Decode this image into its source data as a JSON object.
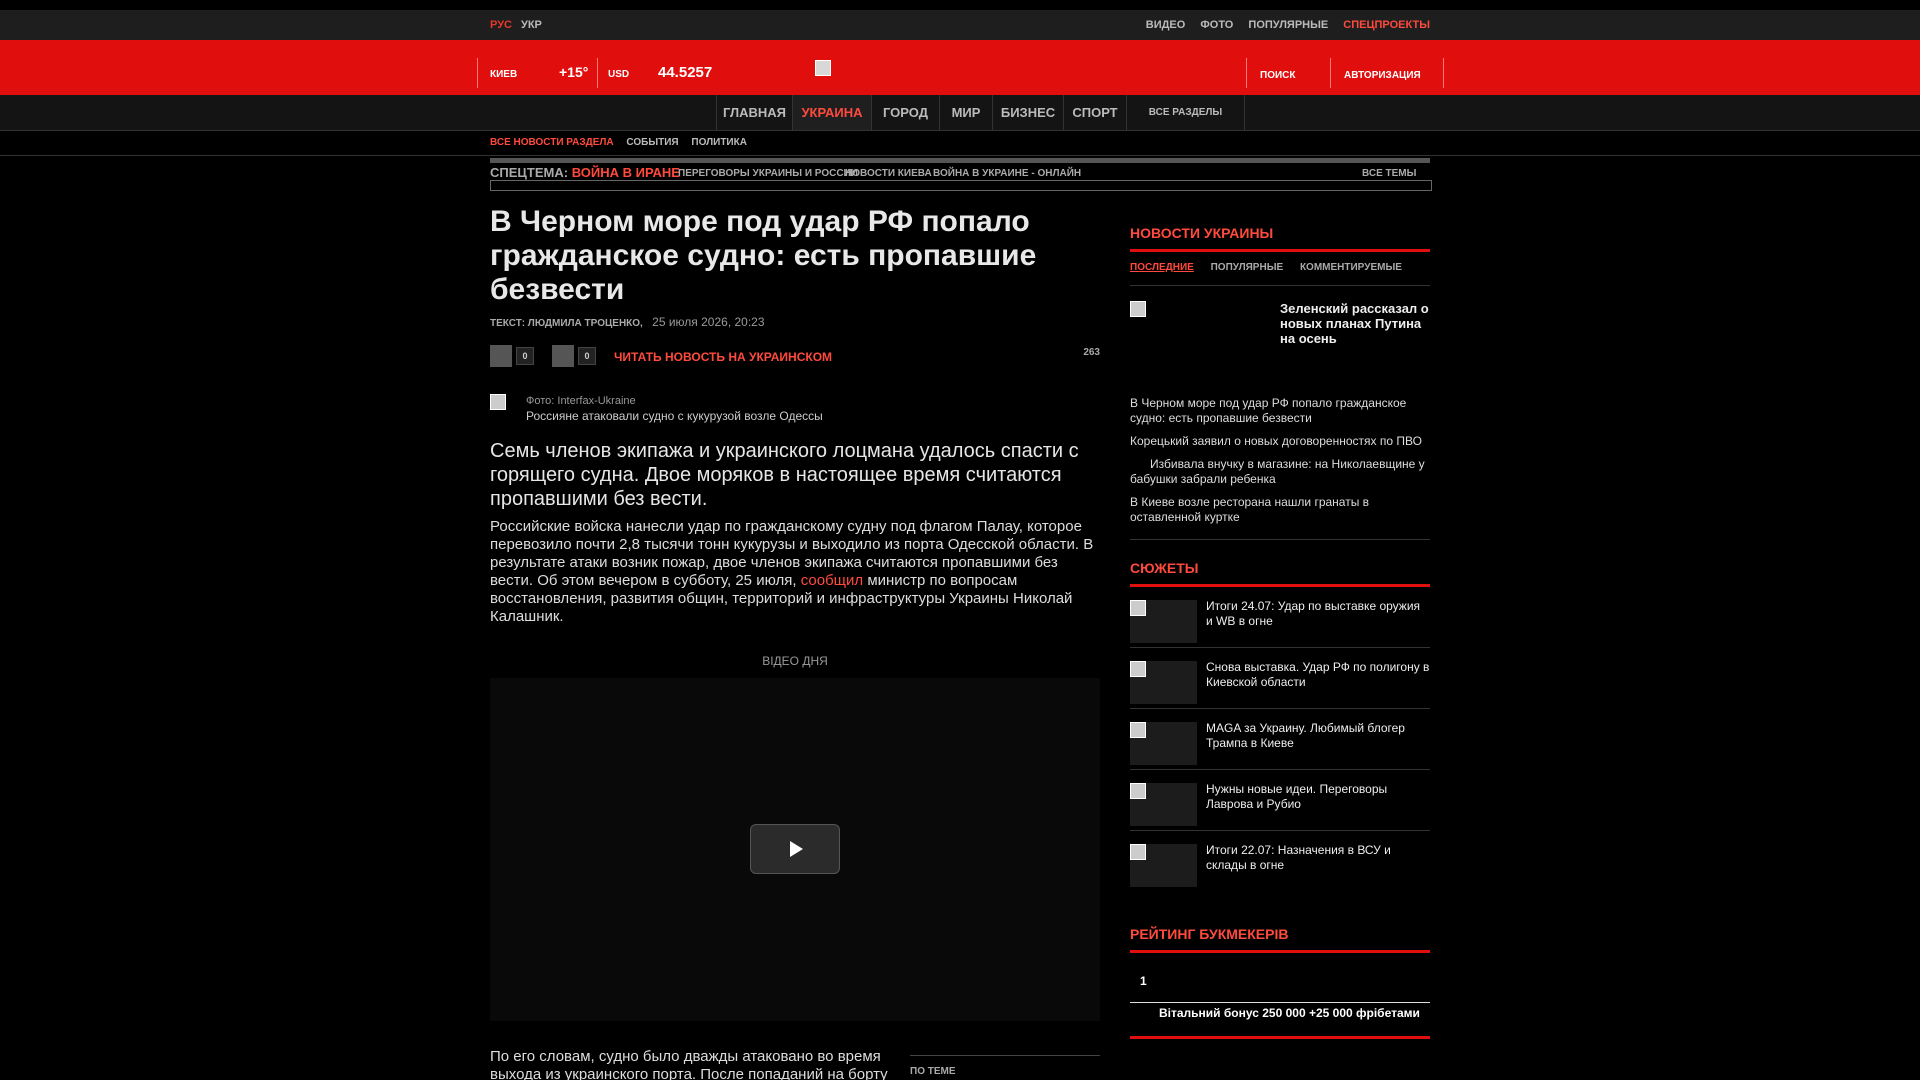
{
  "top": {
    "lang_rus": "РУС",
    "lang_ukr": "УКР",
    "links": [
      "ВИДЕО",
      "ФОТО",
      "ПОПУЛЯРНЫЕ"
    ],
    "special": "СПЕЦПРОЕКТЫ"
  },
  "header": {
    "city": "КИЕВ",
    "temp": "+15°",
    "currency": "USD",
    "rate": "44.5257",
    "search": "ПОИСК",
    "auth": "АВТОРИЗАЦИЯ"
  },
  "nav": {
    "items": [
      "ГЛАВНАЯ",
      "УКРАИНА",
      "ГОРОД",
      "МИР",
      "БИЗНЕС",
      "СПОРТ"
    ],
    "all": "ВСЕ РАЗДЕЛЫ",
    "active_index": 1
  },
  "subnav": [
    "ВСЕ НОВОСТИ РАЗДЕЛА",
    "СОБЫТИЯ",
    "ПОЛИТИКА"
  ],
  "topic": {
    "label": "СПЕЦТЕМА:",
    "highlight": "ВОЙНА В ИРАНЕ",
    "links": [
      "ПЕРЕГОВОРЫ УКРАИНЫ И РОССИИ",
      "НОВОСТИ КИЕВА",
      "ВОЙНА В УКРАИНЕ - ОНЛАЙН"
    ],
    "all": "ВСЕ ТЕМЫ"
  },
  "article": {
    "title": "В Черном море под удар РФ попало гражданское судно: есть пропавшие безвести",
    "author": "ТЕКСТ: ЛЮДМИЛА ТРОЦЕНКО,",
    "date": "25 июля 2026, 20:23",
    "likes": "0",
    "comments": "0",
    "read_ua": "ЧИТАТЬ НОВОСТЬ НА УКРАИНСКОМ",
    "views": "263",
    "photo_credit": "Фото: Interfax-Ukraine",
    "photo_caption": "Россияне атаковали судно с кукурузой возле Одессы",
    "lead": "Семь членов экипажа и украинского лоцмана удалось спасти с горящего судна. Двое моряков в настоящее время считаются пропавшими без вести.",
    "body1_a": "Российские войска нанесли удар по гражданскому судну под флагом Палау, которое перевозило почти 2,8 тысячи тонн кукурузы и выходило из порта Одесской области. В результате атаки возник пожар, двое членов экипажа считаются пропавшими без вести. Об этом вечером в субботу, 25 июля,",
    "body1_link": "сообщил",
    "body1_b": "министр по вопросам восстановления, развития общин, территорий и инфраструктуры Украины Николай Калашник.",
    "video_label": "ВІДЕО ДНЯ",
    "body2": "По его словам, судно было дважды атаковано во время выхода из украинского порта. После попаданий на борту",
    "related": "ПО ТЕМЕ"
  },
  "sidebar": {
    "news_head": "НОВОСТИ УКРАИНЫ",
    "tabs": [
      "ПОСЛЕДНИЕ",
      "ПОПУЛЯРНЫЕ",
      "КОММЕНТИРУЕМЫЕ"
    ],
    "featured": "Зеленский рассказал о новых планах Путина на осень",
    "list": [
      "В Черном море под удар РФ попало гражданское судно: есть пропавшие безвести",
      "Корецький заявил о новых договоренностях по ПВО",
      "Избивала внучку в магазине: на Николаевщине у бабушки забрали ребенка",
      "В Киеве возле ресторана нашли гранаты в оставленной куртке"
    ],
    "stories_head": "СЮЖЕТЫ",
    "stories": [
      "Итоги 24.07: Удар по выставке оружия и WB в огне",
      "Снова выставка. Удар РФ по полигону в Киевской области",
      "MAGA за Украину. Любимый блогер Трампа в Киеве",
      "Нужны новые идеи. Переговоры Лаврова и Рубио",
      "Итоги 22.07: Назначения в ВСУ и склады в огне"
    ],
    "rating_head": "РЕЙТИНГ БУКМЕКЕРІВ",
    "rating_num": "1",
    "bonus": "Вітальний бонус 250 000 +25 000 фрібетами"
  }
}
